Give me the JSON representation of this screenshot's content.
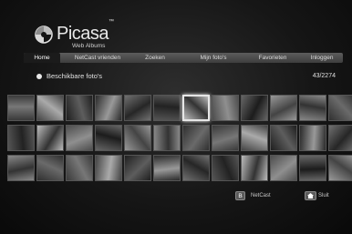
{
  "app": {
    "logo_text": "Picasa",
    "logo_tm": "™",
    "logo_subtitle": "Web Albums"
  },
  "nav": {
    "tabs": [
      {
        "label": "Home",
        "active": true
      },
      {
        "label": "NetCast vrienden",
        "active": false
      },
      {
        "label": "Zoeken",
        "active": false
      },
      {
        "label": "Mijn foto's",
        "active": false
      },
      {
        "label": "Favorieten",
        "active": false
      },
      {
        "label": "Inloggen",
        "active": false
      }
    ]
  },
  "section": {
    "title": "Beschikbare foto's",
    "count": "43/2274"
  },
  "grid": {
    "rows": 3,
    "cols": 12,
    "selected_index": 6
  },
  "footer": {
    "netcast_key": "B",
    "netcast_label": "NetCast",
    "exit_icon": "home-icon",
    "exit_label": "Sluit"
  }
}
